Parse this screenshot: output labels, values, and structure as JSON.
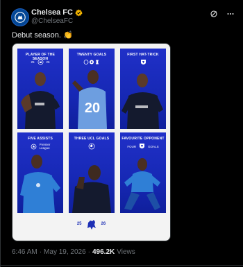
{
  "account": {
    "display_name": "Chelsea FC",
    "handle": "@ChelseaFC",
    "verified_color": "#f4b400",
    "avatar_color": "#034694"
  },
  "tweet": {
    "text": "Debut season. 👏"
  },
  "media": {
    "panels": [
      {
        "title": "PLAYER OF THE SEASON",
        "sub_left": "25",
        "sub_right": "26",
        "icon": "chelsea-crest-icon",
        "number": ""
      },
      {
        "title": "TWENTY GOALS",
        "sub_left": "",
        "sub_right": "",
        "icon": "competition-logos-icon",
        "number": "20"
      },
      {
        "title": "FIRST HAT-TRICK",
        "sub_left": "",
        "sub_right": "",
        "icon": "aston-villa-crest-icon",
        "number": ""
      },
      {
        "title": "FIVE ASSISTS",
        "sub_left": "Premier",
        "sub_right": "League",
        "icon": "premier-league-logo-icon",
        "number": ""
      },
      {
        "title": "THREE UCL GOALS",
        "sub_left": "",
        "sub_right": "",
        "icon": "champions-league-ball-icon",
        "number": ""
      },
      {
        "title": "FAVOURITE OPPONENT",
        "sub_left": "FOUR",
        "sub_right": "GOALS",
        "icon": "aston-villa-crest-icon",
        "number": ""
      }
    ],
    "footer_left": "25",
    "footer_right": "26",
    "panel_color": "#1a2cc0"
  },
  "meta": {
    "time": "6:46 AM",
    "separator": "·",
    "date": "May 19, 2026",
    "separator2": "·",
    "views_count": "496.2K",
    "views_label": "Views"
  }
}
